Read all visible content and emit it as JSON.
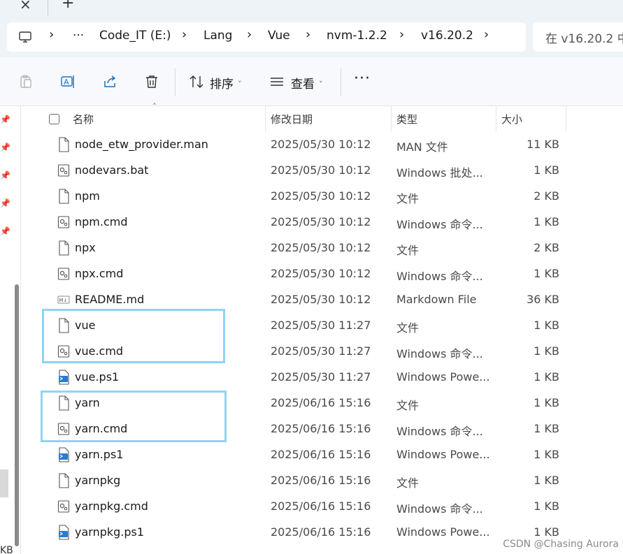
{
  "tabs": {
    "close_glyph": "×",
    "new_glyph": "+"
  },
  "address": {
    "more_glyph": "···",
    "crumbs": [
      "Code_IT (E:)",
      "Lang",
      "Vue",
      "nvm-1.2.2",
      "v16.20.2"
    ],
    "chevron": "›"
  },
  "search": {
    "placeholder": "在 v16.20.2 中"
  },
  "toolbar": {
    "sort_label": "排序",
    "view_label": "查看",
    "caret": "˅",
    "more": "···"
  },
  "columns": {
    "name": "名称",
    "date": "修改日期",
    "type": "类型",
    "size": "大小",
    "sort_glyph": "˄"
  },
  "files": [
    {
      "name": "node_etw_provider.man",
      "date": "2025/05/30 10:12",
      "type": "MAN 文件",
      "size": "11 KB",
      "icon": "file-icon"
    },
    {
      "name": "nodevars.bat",
      "date": "2025/05/30 10:12",
      "type": "Windows 批处...",
      "size": "1 KB",
      "icon": "script-icon"
    },
    {
      "name": "npm",
      "date": "2025/05/30 10:12",
      "type": "文件",
      "size": "2 KB",
      "icon": "file-icon"
    },
    {
      "name": "npm.cmd",
      "date": "2025/05/30 10:12",
      "type": "Windows 命令...",
      "size": "1 KB",
      "icon": "script-icon"
    },
    {
      "name": "npx",
      "date": "2025/05/30 10:12",
      "type": "文件",
      "size": "2 KB",
      "icon": "file-icon"
    },
    {
      "name": "npx.cmd",
      "date": "2025/05/30 10:12",
      "type": "Windows 命令...",
      "size": "1 KB",
      "icon": "script-icon"
    },
    {
      "name": "README.md",
      "date": "2025/05/30 10:12",
      "type": "Markdown File",
      "size": "36 KB",
      "icon": "markdown-icon"
    },
    {
      "name": "vue",
      "date": "2025/05/30 11:27",
      "type": "文件",
      "size": "1 KB",
      "icon": "file-icon"
    },
    {
      "name": "vue.cmd",
      "date": "2025/05/30 11:27",
      "type": "Windows 命令...",
      "size": "1 KB",
      "icon": "script-icon"
    },
    {
      "name": "vue.ps1",
      "date": "2025/05/30 11:27",
      "type": "Windows Powe...",
      "size": "1 KB",
      "icon": "powershell-icon"
    },
    {
      "name": "yarn",
      "date": "2025/06/16 15:16",
      "type": "文件",
      "size": "1 KB",
      "icon": "file-icon"
    },
    {
      "name": "yarn.cmd",
      "date": "2025/06/16 15:16",
      "type": "Windows 命令...",
      "size": "1 KB",
      "icon": "script-icon"
    },
    {
      "name": "yarn.ps1",
      "date": "2025/06/16 15:16",
      "type": "Windows Powe...",
      "size": "1 KB",
      "icon": "powershell-icon"
    },
    {
      "name": "yarnpkg",
      "date": "2025/06/16 15:16",
      "type": "文件",
      "size": "1 KB",
      "icon": "file-icon"
    },
    {
      "name": "yarnpkg.cmd",
      "date": "2025/06/16 15:16",
      "type": "Windows 命令...",
      "size": "1 KB",
      "icon": "script-icon"
    },
    {
      "name": "yarnpkg.ps1",
      "date": "2025/06/16 15:16",
      "type": "Windows Powe...",
      "size": "1 KB",
      "icon": "powershell-icon"
    }
  ],
  "left_pane": {
    "size_fragment": "KB"
  },
  "watermark": "CSDN @Chasing Aurora",
  "colors": {
    "highlight": "#8fd3f5",
    "chrome": "#eef3f8"
  }
}
